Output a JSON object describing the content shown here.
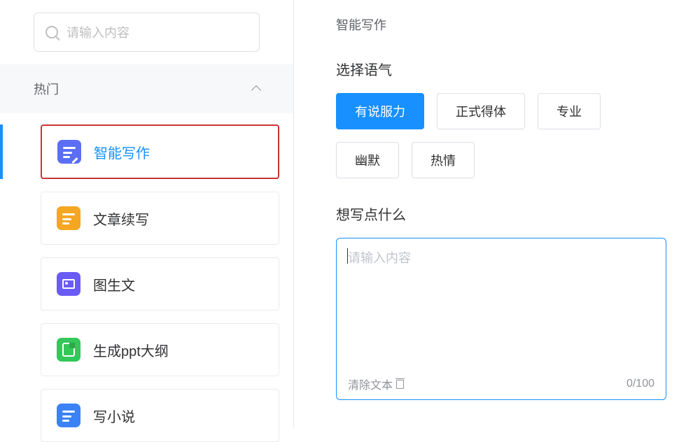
{
  "search": {
    "placeholder": "请输入内容"
  },
  "section": {
    "title": "热门"
  },
  "menu": {
    "items": [
      {
        "label": "智能写作",
        "color": "blue"
      },
      {
        "label": "文章续写",
        "color": "orange"
      },
      {
        "label": "图生文",
        "color": "purple"
      },
      {
        "label": "生成ppt大纲",
        "color": "green"
      },
      {
        "label": "写小说",
        "color": "blue2"
      }
    ]
  },
  "main": {
    "title": "智能写作",
    "tone_label": "选择语气",
    "tones": [
      {
        "label": "有说服力",
        "active": true
      },
      {
        "label": "正式得体",
        "active": false
      },
      {
        "label": "专业",
        "active": false
      },
      {
        "label": "幽默",
        "active": false
      },
      {
        "label": "热情",
        "active": false
      }
    ],
    "prompt_label": "想写点什么",
    "textarea_placeholder": "请输入内容",
    "clear_label": "清除文本",
    "counter": "0/100"
  }
}
